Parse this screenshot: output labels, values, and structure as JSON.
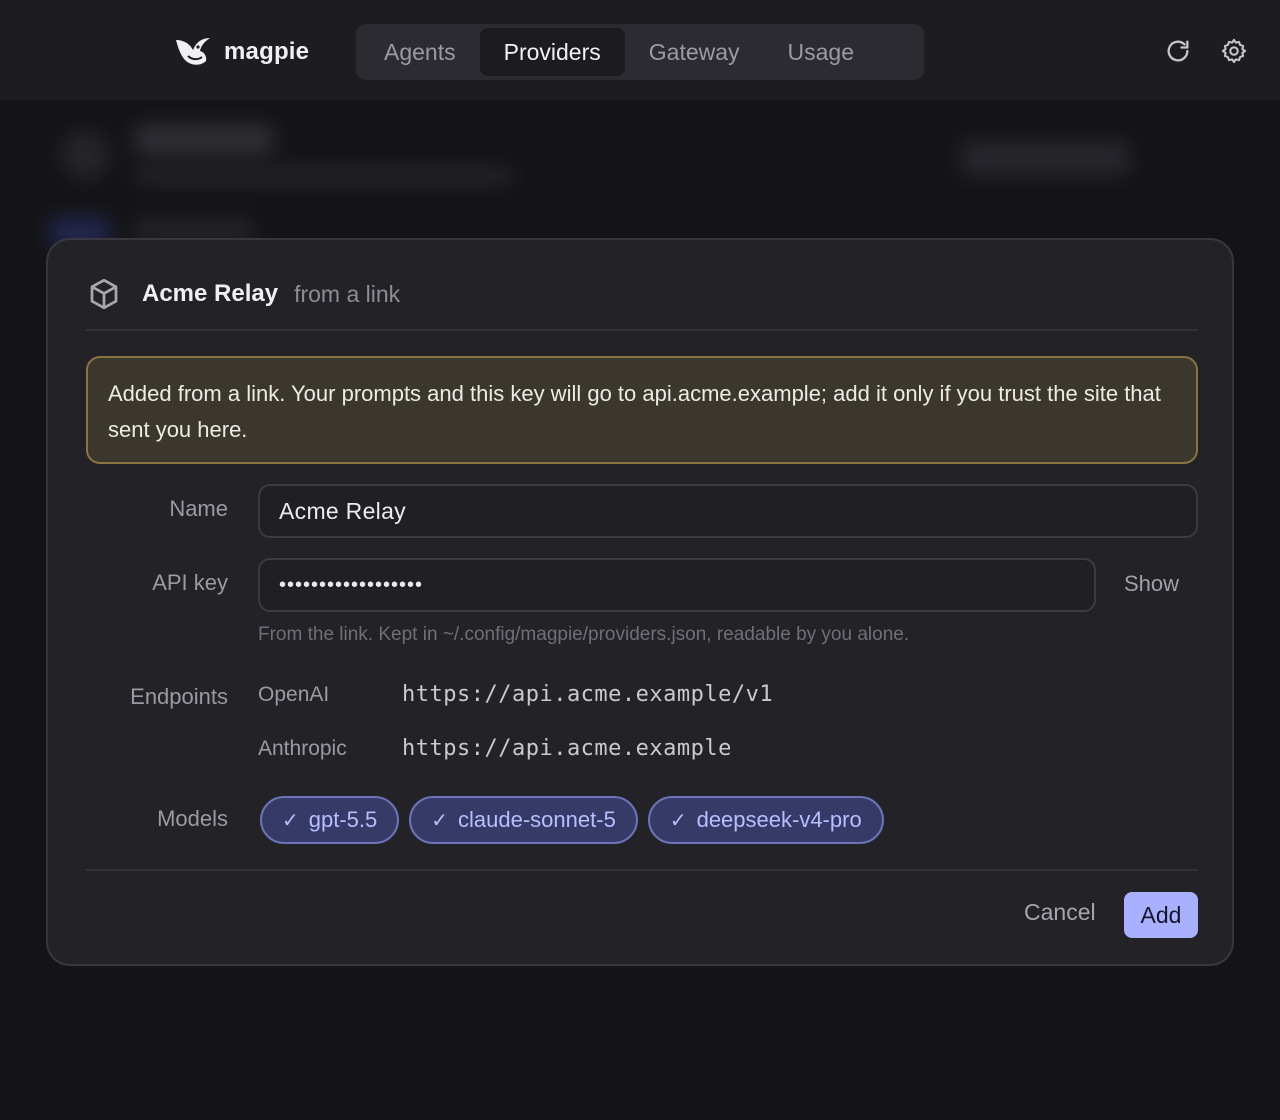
{
  "app": {
    "name": "magpie"
  },
  "nav": {
    "tabs": [
      {
        "label": "Agents",
        "active": false
      },
      {
        "label": "Providers",
        "active": true
      },
      {
        "label": "Gateway",
        "active": false
      },
      {
        "label": "Usage",
        "active": false
      }
    ]
  },
  "toolbar": {
    "refresh_icon": "refresh-icon",
    "settings_icon": "gear-icon"
  },
  "dialog": {
    "icon": "cube-icon",
    "title": "Acme Relay",
    "subtitle": "from a link",
    "warning": "Added from a link. Your prompts and this key will go to api.acme.example; add it only if you trust the site that sent you here.",
    "name_label": "Name",
    "name_value": "Acme Relay",
    "api_key_label": "API key",
    "api_key_value": "••••••••••••••••••",
    "show_label": "Show",
    "api_key_hint": "From the link. Kept in ~/.config/magpie/providers.json, readable by you alone.",
    "endpoints_label": "Endpoints",
    "endpoints": [
      {
        "name": "OpenAI",
        "url": "https://api.acme.example/v1"
      },
      {
        "name": "Anthropic",
        "url": "https://api.acme.example"
      }
    ],
    "models_label": "Models",
    "models": [
      {
        "check": "✓",
        "name": "gpt-5.5"
      },
      {
        "check": "✓",
        "name": "claude-sonnet-5"
      },
      {
        "check": "✓",
        "name": "deepseek-v4-pro"
      }
    ],
    "cancel_label": "Cancel",
    "add_label": "Add"
  },
  "colors": {
    "accent": "#a9b0ff",
    "warning_border": "#8a7440",
    "chip_border": "#6c73b8"
  }
}
